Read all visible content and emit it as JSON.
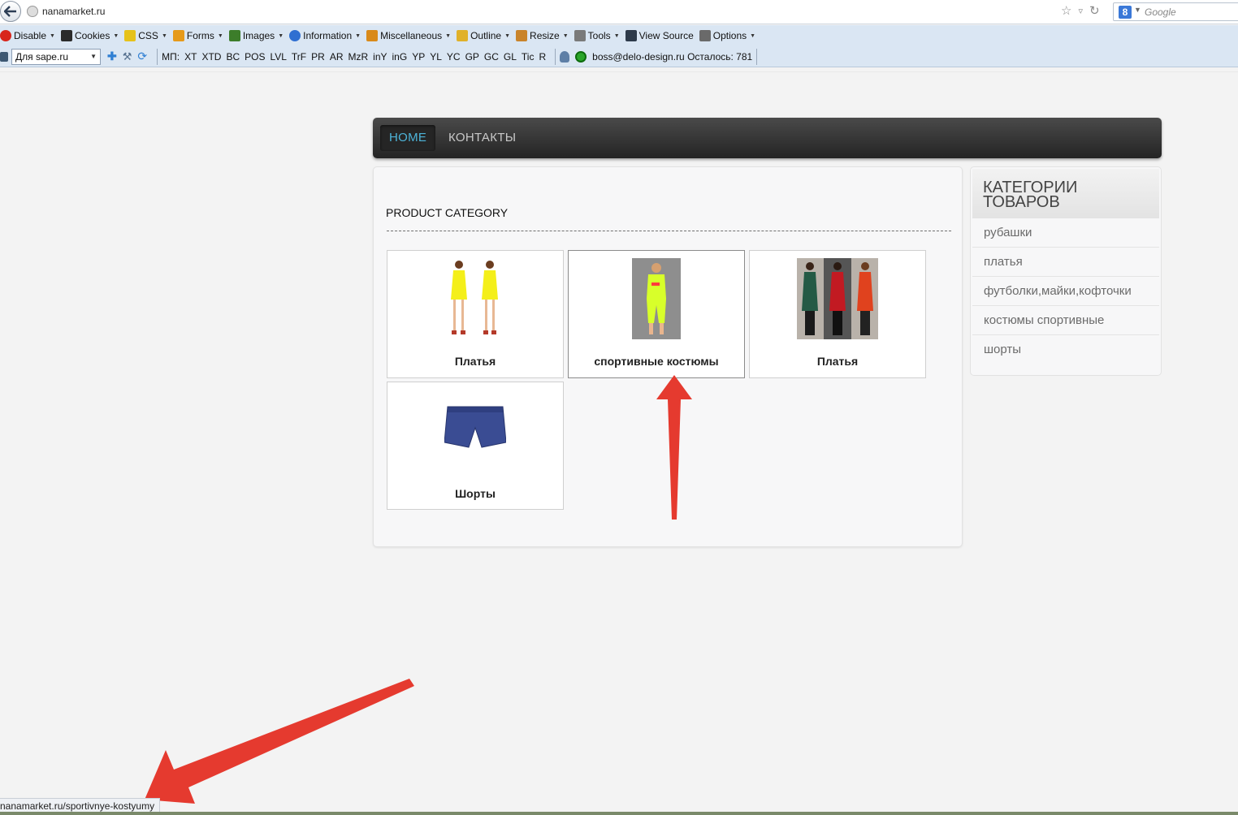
{
  "browser": {
    "url": "nanamarket.ru",
    "search_placeholder": "Google",
    "search_engine_icon": "google-icon"
  },
  "webdev_toolbar": {
    "items": [
      "Disable",
      "Cookies",
      "CSS",
      "Forms",
      "Images",
      "Information",
      "Miscellaneous",
      "Outline",
      "Resize",
      "Tools",
      "View Source",
      "Options"
    ]
  },
  "seo_toolbar": {
    "select_value": "Для sape.ru",
    "metrics_label": "МП:",
    "metrics": [
      "XT",
      "XTD",
      "BC",
      "POS",
      "LVL",
      "TrF",
      "PR",
      "AR",
      "MzR",
      "inY",
      "inG",
      "YP",
      "YL",
      "YC",
      "GP",
      "GC",
      "GL",
      "Tic",
      "R"
    ],
    "account": "boss@delo-design.ru Осталось: 781"
  },
  "nav": {
    "home": "HOME",
    "contacts": "КОНТАКТЫ"
  },
  "main": {
    "title": "PRODUCT CATEGORY",
    "cards": [
      {
        "label": "Платья"
      },
      {
        "label": "спортивные костюмы"
      },
      {
        "label": "Платья"
      },
      {
        "label": "Шорты"
      }
    ]
  },
  "sidebar": {
    "title": "КАТЕГОРИИ ТОВАРОВ",
    "items": [
      "рубашки",
      "платья",
      "футболки,майки,кофточки",
      "костюмы спортивные",
      "шорты"
    ]
  },
  "status": {
    "url": "nanamarket.ru/sportivnye-kostyumy"
  },
  "colors": {
    "annotation_arrow": "#e53a2f",
    "nav_active": "#4db3d8"
  }
}
